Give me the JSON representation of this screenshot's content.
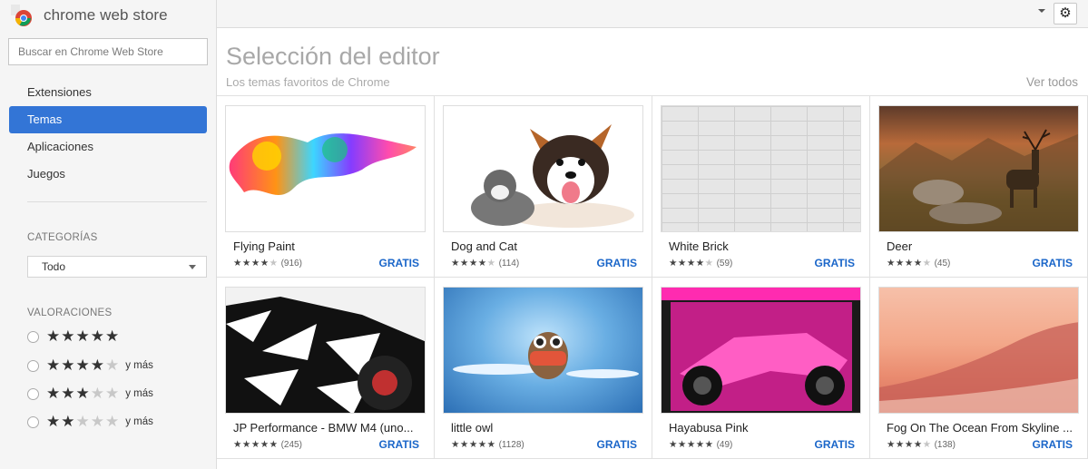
{
  "app": {
    "title": "chrome web store"
  },
  "search": {
    "placeholder": "Buscar en Chrome Web Store"
  },
  "nav": [
    {
      "label": "Extensiones",
      "active": false
    },
    {
      "label": "Temas",
      "active": true
    },
    {
      "label": "Aplicaciones",
      "active": false
    },
    {
      "label": "Juegos",
      "active": false
    }
  ],
  "categories": {
    "label": "CATEGORÍAS",
    "selected": "Todo"
  },
  "ratings": {
    "label": "VALORACIONES",
    "options": [
      {
        "stars": 5,
        "suffix": ""
      },
      {
        "stars": 4,
        "suffix": "y más"
      },
      {
        "stars": 3,
        "suffix": "y más"
      },
      {
        "stars": 2,
        "suffix": "y más"
      }
    ]
  },
  "section": {
    "title": "Selección del editor",
    "subtitle": "Los temas favoritos de Chrome",
    "see_all": "Ver todos"
  },
  "items": [
    {
      "name": "Flying Paint",
      "rating": 4,
      "count": "(916)",
      "price": "GRATIS",
      "thumb": "paint"
    },
    {
      "name": "Dog and Cat",
      "rating": 4,
      "count": "(114)",
      "price": "GRATIS",
      "thumb": "dog"
    },
    {
      "name": "White Brick",
      "rating": 4,
      "count": "(59)",
      "price": "GRATIS",
      "thumb": "brick"
    },
    {
      "name": "Deer",
      "rating": 4,
      "count": "(45)",
      "price": "GRATIS",
      "thumb": "deer"
    },
    {
      "name": "JP Performance - BMW M4 (uno...",
      "rating": 5,
      "count": "(245)",
      "price": "GRATIS",
      "thumb": "bmw"
    },
    {
      "name": "little owl",
      "rating": 5,
      "count": "(1128)",
      "price": "GRATIS",
      "thumb": "owl"
    },
    {
      "name": "Hayabusa Pink",
      "rating": 4.5,
      "count": "(49)",
      "price": "GRATIS",
      "thumb": "haya"
    },
    {
      "name": "Fog On The Ocean From Skyline ...",
      "rating": 4,
      "count": "(138)",
      "price": "GRATIS",
      "thumb": "fog"
    }
  ],
  "colors": {
    "accent": "#3375d6",
    "price": "#1a66c9"
  },
  "icons": {
    "settings": "gear-icon",
    "menu": "chevron-down-icon"
  }
}
